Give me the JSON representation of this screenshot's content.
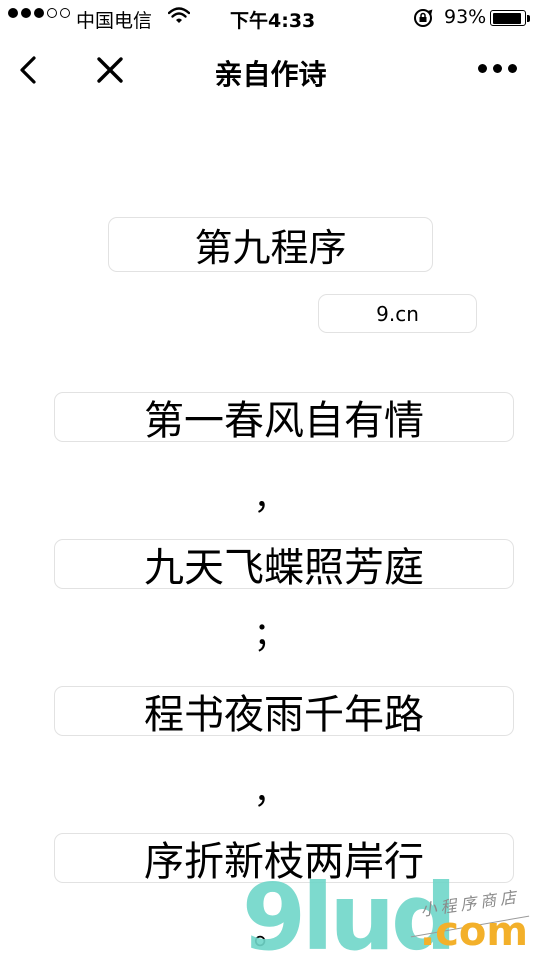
{
  "status_bar": {
    "carrier": "中国电信",
    "time": "下午4:33",
    "battery_pct": "93%",
    "battery_level": 0.93,
    "signal_bars_filled": 3,
    "signal_bars_total": 5
  },
  "nav": {
    "title": "亲自作诗"
  },
  "poem": {
    "heading": "第九程序",
    "site": "9.cn",
    "lines": [
      {
        "text": "第一春风自有情",
        "punct": "，"
      },
      {
        "text": "九天飞蝶照芳庭",
        "punct": "；"
      },
      {
        "text": "程书夜雨千年路",
        "punct": "，"
      },
      {
        "text": "序折新枝两岸行",
        "punct": "。"
      }
    ]
  },
  "watermark": {
    "number": "9lud",
    "domain": ".com",
    "slogan": "小程序商店"
  }
}
